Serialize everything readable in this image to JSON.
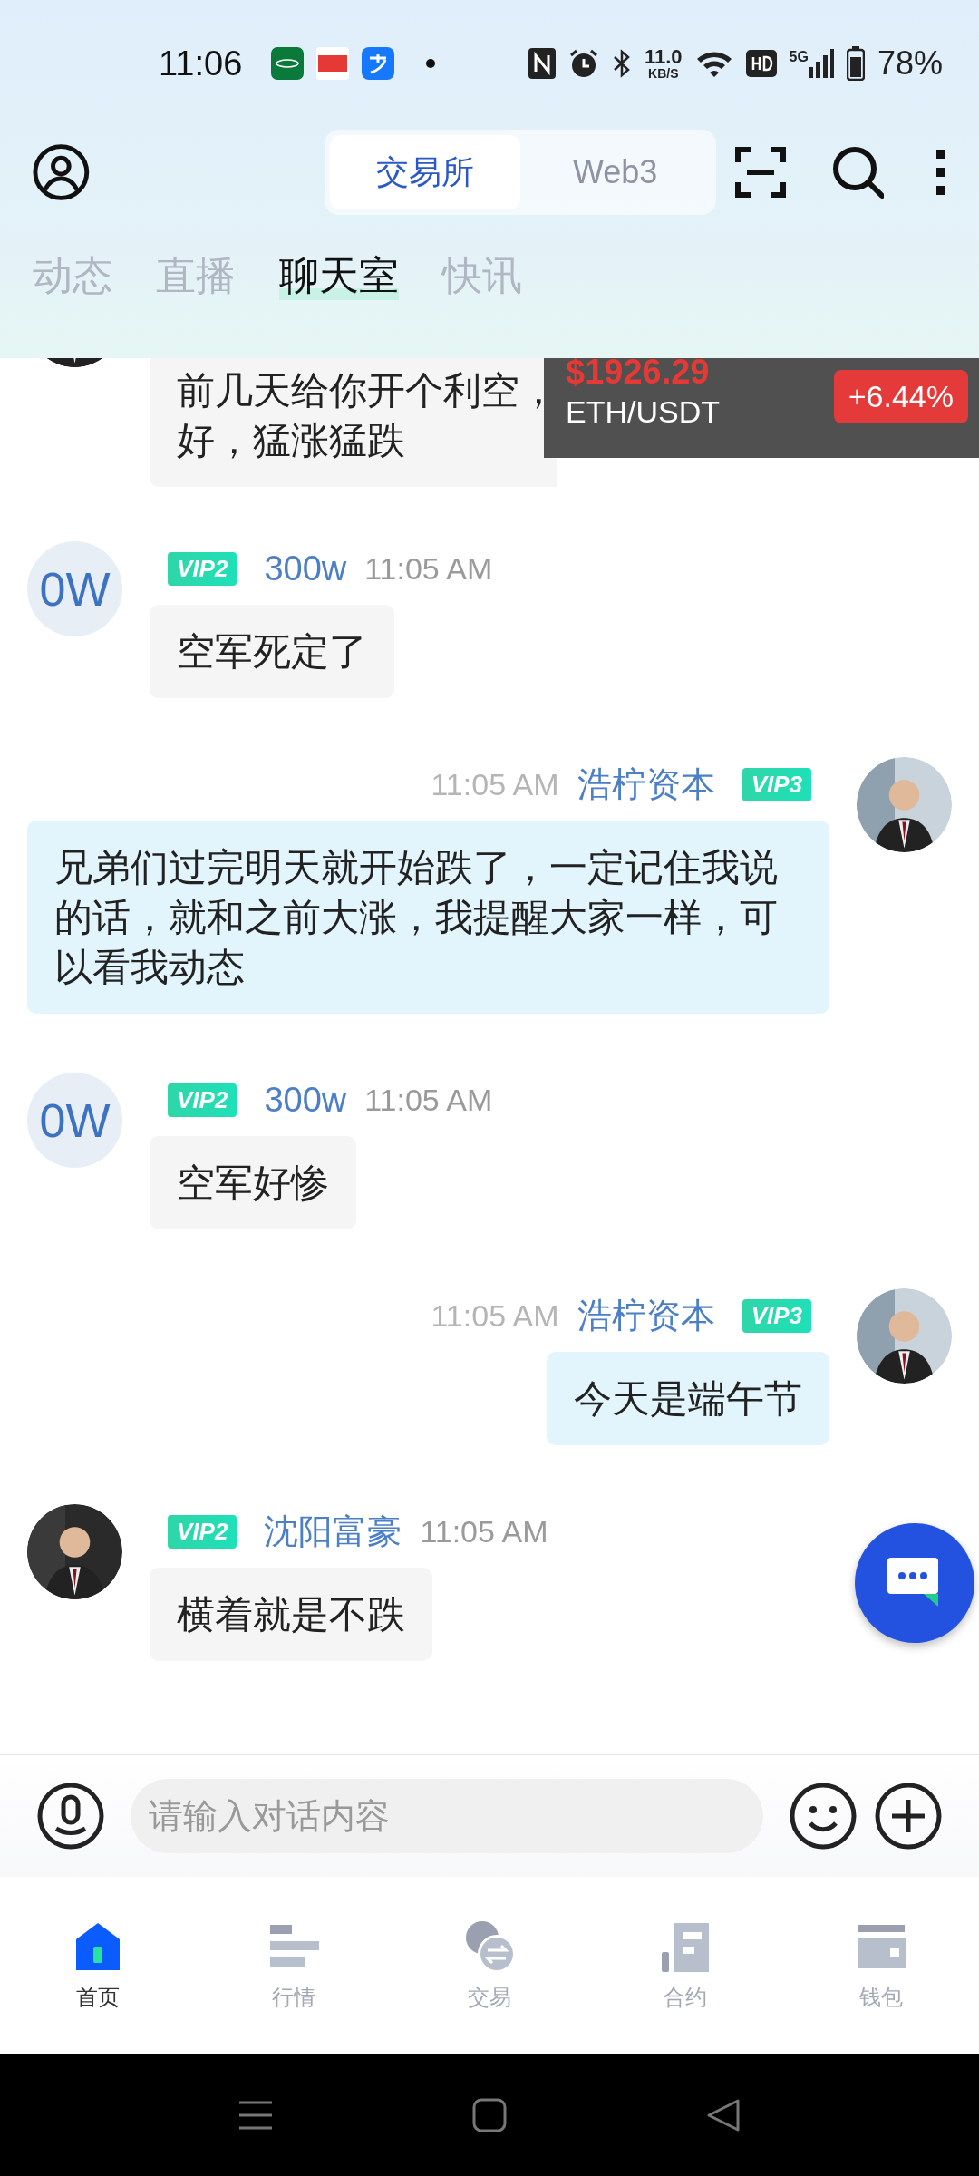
{
  "status_bar": {
    "time": "11:06",
    "speed_value": "11.0",
    "speed_unit": "KB/S",
    "network": "5G",
    "battery": "78%"
  },
  "header": {
    "segments": [
      {
        "label": "交易所",
        "selected": true
      },
      {
        "label": "Web3",
        "selected": false
      }
    ]
  },
  "tabs": [
    {
      "label": "动态",
      "selected": false
    },
    {
      "label": "直播",
      "selected": false
    },
    {
      "label": "聊天室",
      "selected": true
    },
    {
      "label": "快讯",
      "selected": false
    }
  ],
  "messages": [
    {
      "outgoing": false,
      "partial": true,
      "avatar": {
        "kind": "picture"
      },
      "lines": [
        "前几天给你开个利空，",
        "好，猛涨猛跌"
      ]
    },
    {
      "outgoing": false,
      "partial": false,
      "avatar": {
        "kind": "text",
        "text": "0W"
      },
      "vip": "VIP2",
      "name": "300w",
      "time": "11:05 AM",
      "lines": [
        "空军死定了"
      ]
    },
    {
      "outgoing": true,
      "partial": false,
      "avatar": {
        "kind": "picture"
      },
      "vip": "VIP3",
      "name": "浩柠资本",
      "time": "11:05 AM",
      "lines": [
        "兄弟们过完明天就开始跌了，一定记住我说的话，就和之前大涨，我提醒大家一样，可以看我动态"
      ]
    },
    {
      "outgoing": false,
      "partial": false,
      "avatar": {
        "kind": "text",
        "text": "0W"
      },
      "vip": "VIP2",
      "name": "300w",
      "time": "11:05 AM",
      "lines": [
        "空军好惨"
      ]
    },
    {
      "outgoing": true,
      "partial": false,
      "avatar": {
        "kind": "picture"
      },
      "vip": "VIP3",
      "name": "浩柠资本",
      "time": "11:05 AM",
      "lines": [
        "今天是端午节"
      ]
    },
    {
      "outgoing": false,
      "partial": false,
      "avatar": {
        "kind": "picture"
      },
      "vip": "VIP2",
      "name": "沈阳富豪",
      "time": "11:05 AM",
      "lines": [
        "横着就是不跌"
      ]
    }
  ],
  "ticker": {
    "price": "$1926.29",
    "pair": "ETH/USDT",
    "change": "+6.44%"
  },
  "input": {
    "placeholder": "请输入对话内容"
  },
  "nav": [
    {
      "label": "首页",
      "selected": true
    },
    {
      "label": "行情",
      "selected": false
    },
    {
      "label": "交易",
      "selected": false
    },
    {
      "label": "合约",
      "selected": false
    },
    {
      "label": "钱包",
      "selected": false
    }
  ]
}
